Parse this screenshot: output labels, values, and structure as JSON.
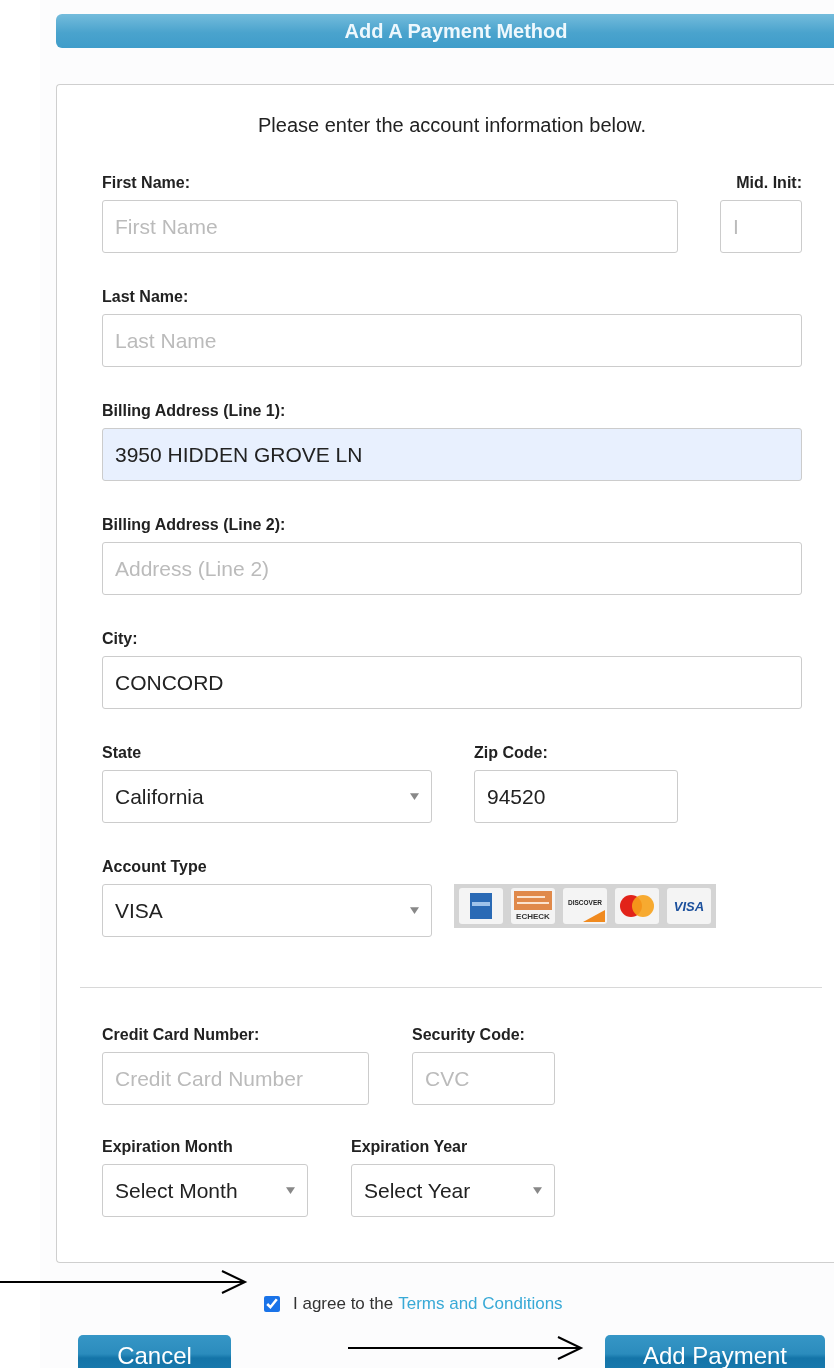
{
  "header": {
    "title": "Add A Payment Method"
  },
  "instructions": "Please enter the account information below.",
  "first_name": {
    "label": "First Name:",
    "placeholder": "First Name",
    "autofilled": false
  },
  "middle_initial": {
    "label": "Mid. Init:",
    "placeholder": "I",
    "autofilled": false
  },
  "last_name": {
    "label": "Last Name:",
    "placeholder": "Last Name",
    "autofilled": false
  },
  "billing_address_1": {
    "label": "Billing Address (Line 1):",
    "value": "3950 HIDDEN GROVE LN",
    "autofilled": true
  },
  "billing_address_2": {
    "label": "Billing Address (Line 2):",
    "placeholder": "Address (Line 2)",
    "autofilled": false
  },
  "city": {
    "label": "City:",
    "value": "CONCORD",
    "autofilled": false
  },
  "state": {
    "label": "State",
    "value": "California"
  },
  "zip_code": {
    "label": "Zip Code:",
    "value": "94520",
    "autofilled": false
  },
  "account_type": {
    "label": "Account Type",
    "value": "VISA"
  },
  "card_logos": [
    {
      "kind": "amex"
    },
    {
      "kind": "echeck",
      "label": "ECHECK"
    },
    {
      "kind": "discover",
      "label": "DISCOVER"
    },
    {
      "kind": "mastercard"
    },
    {
      "kind": "visa",
      "label": "VISA"
    }
  ],
  "card_number": {
    "label": "Credit Card Number:",
    "placeholder": "Credit Card Number",
    "autofilled": false
  },
  "security_code": {
    "label": "Security Code:",
    "placeholder": "CVC",
    "autofilled": false
  },
  "expiration_month": {
    "label": "Expiration Month",
    "value": "Select Month"
  },
  "expiration_year": {
    "label": "Expiration Year",
    "value": "Select Year"
  },
  "agreement": {
    "checked": true,
    "text": "I agree to the",
    "link": "Terms and Conditions"
  },
  "buttons": {
    "cancel": "Cancel",
    "submit": "Add Payment"
  }
}
